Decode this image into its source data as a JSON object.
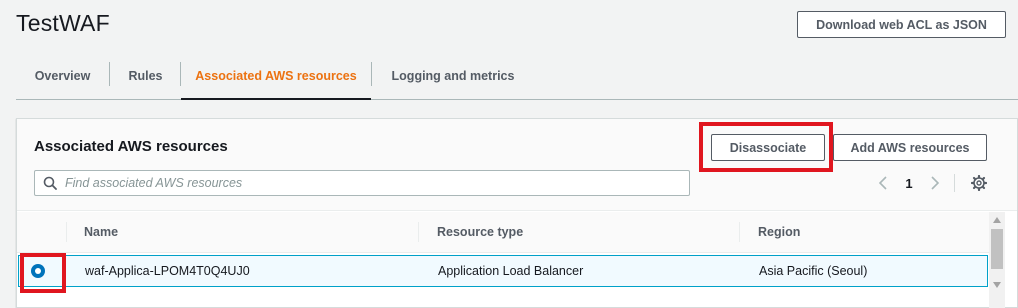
{
  "page": {
    "title": "TestWAF",
    "download_button": "Download web ACL as JSON"
  },
  "tabs": [
    {
      "label": "Overview",
      "active": false
    },
    {
      "label": "Rules",
      "active": false
    },
    {
      "label": "Associated AWS resources",
      "active": true
    },
    {
      "label": "Logging and metrics",
      "active": false
    }
  ],
  "panel": {
    "title": "Associated AWS resources",
    "disassociate_button": "Disassociate",
    "add_button": "Add AWS resources",
    "search": {
      "placeholder": "Find associated AWS resources",
      "value": ""
    },
    "pagination": {
      "current_page": "1"
    }
  },
  "table": {
    "columns": [
      "Name",
      "Resource type",
      "Region"
    ],
    "rows": [
      {
        "selected": true,
        "name": "waf-Applica-LPOM4T0Q4UJ0",
        "resource_type": "Application Load Balancer",
        "region": "Asia Pacific (Seoul)"
      }
    ]
  },
  "colors": {
    "accent": "#ec7211",
    "primary_text": "#16191f",
    "secondary_text": "#545b64",
    "selection_blue": "#0073bb",
    "highlight_red": "#e0161f"
  },
  "icons": [
    "search-icon",
    "chevron-left-icon",
    "chevron-right-icon",
    "gear-icon",
    "radio-selected-icon"
  ]
}
